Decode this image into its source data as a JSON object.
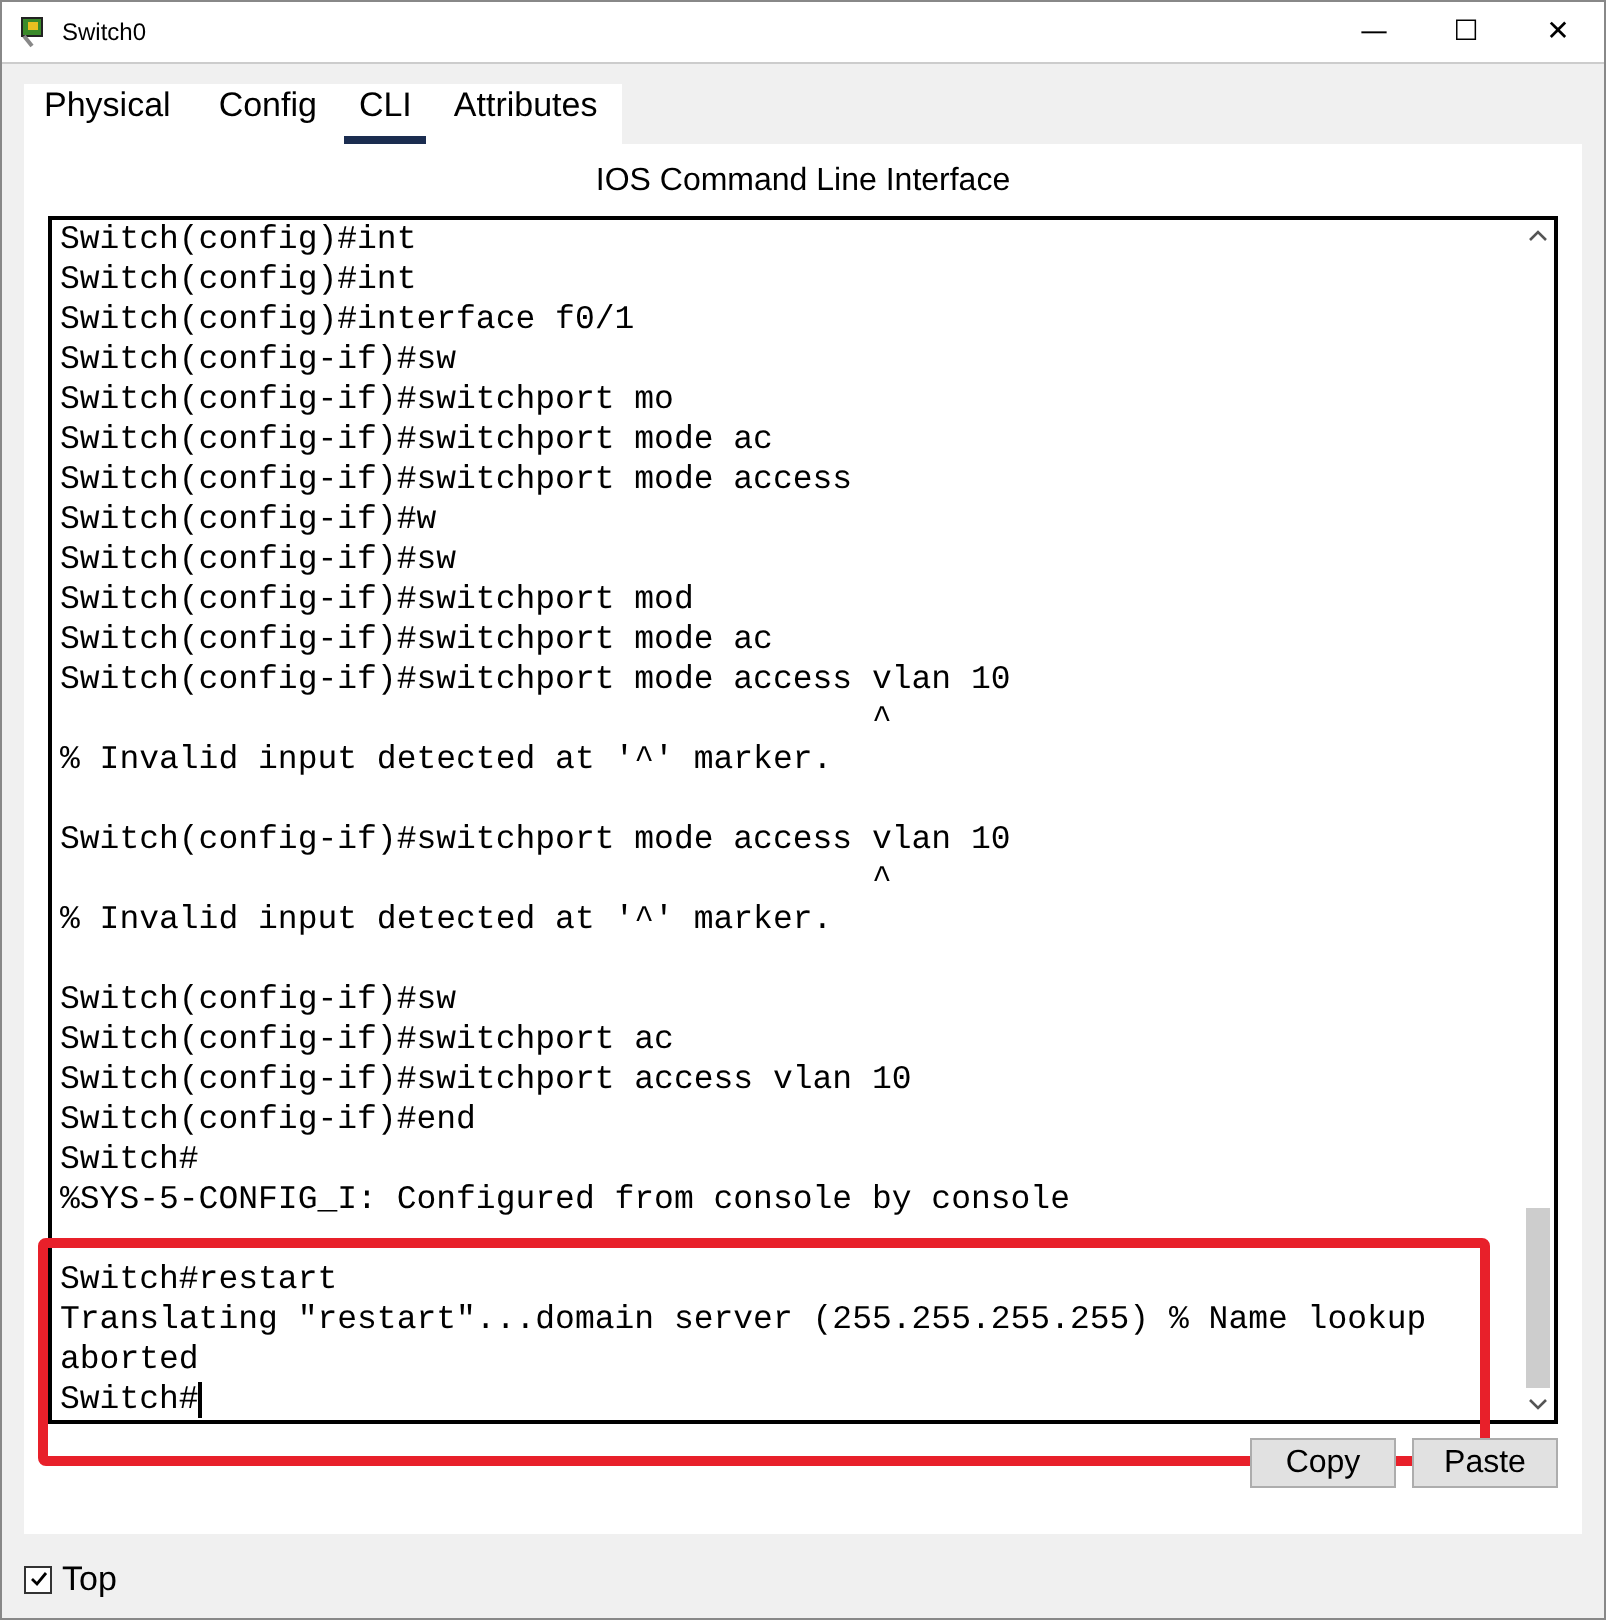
{
  "window": {
    "title": "Switch0",
    "controls": [
      "—",
      "☐",
      "✕"
    ]
  },
  "tabs": [
    {
      "label": "Physical",
      "selected": false
    },
    {
      "label": "Config",
      "selected": false
    },
    {
      "label": "CLI",
      "selected": true
    },
    {
      "label": "Attributes",
      "selected": false
    }
  ],
  "cli": {
    "heading": "IOS Command Line Interface",
    "lines": [
      {
        "kind": "text",
        "text": "Switch(config)#int"
      },
      {
        "kind": "text",
        "text": "Switch(config)#int"
      },
      {
        "kind": "text",
        "text": "Switch(config)#interface f0/1"
      },
      {
        "kind": "text",
        "text": "Switch(config-if)#sw"
      },
      {
        "kind": "text",
        "text": "Switch(config-if)#switchport mo"
      },
      {
        "kind": "text",
        "text": "Switch(config-if)#switchport mode ac"
      },
      {
        "kind": "text",
        "text": "Switch(config-if)#switchport mode access"
      },
      {
        "kind": "text",
        "text": "Switch(config-if)#w"
      },
      {
        "kind": "text",
        "text": "Switch(config-if)#sw"
      },
      {
        "kind": "text",
        "text": "Switch(config-if)#switchport mod"
      },
      {
        "kind": "text",
        "text": "Switch(config-if)#switchport mode ac"
      },
      {
        "kind": "text",
        "text": "Switch(config-if)#switchport mode access vlan 10"
      },
      {
        "kind": "text",
        "text": "                                         ^"
      },
      {
        "kind": "text",
        "text": "% Invalid input detected at '^' marker."
      },
      {
        "kind": "blank"
      },
      {
        "kind": "text",
        "text": "Switch(config-if)#switchport mode access vlan 10"
      },
      {
        "kind": "text",
        "text": "                                         ^"
      },
      {
        "kind": "text",
        "text": "% Invalid input detected at '^' marker."
      },
      {
        "kind": "blank"
      },
      {
        "kind": "text",
        "text": "Switch(config-if)#sw"
      },
      {
        "kind": "text",
        "text": "Switch(config-if)#switchport ac"
      },
      {
        "kind": "text",
        "text": "Switch(config-if)#switchport access vlan 10"
      },
      {
        "kind": "text",
        "text": "Switch(config-if)#end"
      },
      {
        "kind": "text",
        "text": "Switch#"
      },
      {
        "kind": "text",
        "text": "%SYS-5-CONFIG_I: Configured from console by console"
      },
      {
        "kind": "blank"
      },
      {
        "kind": "text",
        "text": "Switch#restart"
      },
      {
        "kind": "text",
        "text": "Translating \"restart\"...domain server (255.255.255.255) % Name lookup"
      },
      {
        "kind": "text",
        "text": "aborted"
      },
      {
        "kind": "prompt",
        "text": "Switch#"
      }
    ],
    "buttons": [
      "Copy",
      "Paste"
    ]
  },
  "top_checkbox": {
    "label": "Top",
    "checked": true
  }
}
